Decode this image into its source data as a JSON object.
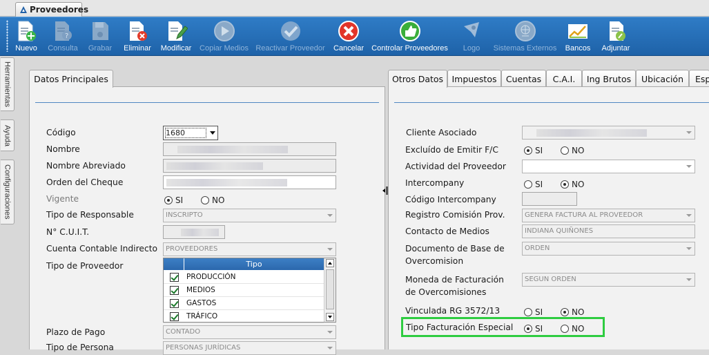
{
  "window": {
    "tab_title": "Proveedores"
  },
  "toolbar": [
    {
      "label": "Nuevo",
      "icon": "new-document-icon",
      "enabled": true
    },
    {
      "label": "Consulta",
      "icon": "query-document-icon",
      "enabled": false
    },
    {
      "label": "Grabar",
      "icon": "save-disk-icon",
      "enabled": false
    },
    {
      "label": "Eliminar",
      "icon": "delete-document-icon",
      "enabled": true
    },
    {
      "label": "Modificar",
      "icon": "edit-document-icon",
      "enabled": true
    },
    {
      "label": "Copiar Medios",
      "icon": "play-circle-icon",
      "enabled": false
    },
    {
      "label": "Reactivar Proveedor",
      "icon": "checkmark-icon",
      "enabled": false
    },
    {
      "label": "Cancelar",
      "icon": "cancel-x-icon",
      "enabled": true
    },
    {
      "label": "Controlar Proveedores",
      "icon": "thumbs-up-icon",
      "enabled": true
    },
    {
      "label": "Logo",
      "icon": "rocket-icon",
      "enabled": false
    },
    {
      "label": "Sistemas Externos",
      "icon": "globe-icon",
      "enabled": false
    },
    {
      "label": "Bancos",
      "icon": "chart-trend-icon",
      "enabled": true
    },
    {
      "label": "Adjuntar",
      "icon": "attach-document-icon",
      "enabled": true
    }
  ],
  "side_tabs": [
    "Herramientas",
    "Ayuda",
    "Configuraciones"
  ],
  "left_panel": {
    "tab": "Datos Principales",
    "codigo": {
      "label": "Código",
      "value": "1680"
    },
    "nombre": {
      "label": "Nombre"
    },
    "nombre_abreviado": {
      "label": "Nombre Abreviado"
    },
    "orden_cheque": {
      "label": "Orden del Cheque"
    },
    "vigente": {
      "label": "Vigente",
      "yes": "SI",
      "no": "NO",
      "selected": "SI"
    },
    "tipo_responsable": {
      "label": "Tipo de Responsable",
      "value": "INSCRIPTO"
    },
    "cuit": {
      "label": "N° C.U.I.T."
    },
    "cuenta_contable": {
      "label": "Cuenta Contable Indirecto",
      "value": "PROVEEDORES"
    },
    "tipo_proveedor": {
      "label": "Tipo de Proveedor",
      "column": "Tipo",
      "rows": [
        {
          "name": "PRODUCCIÓN",
          "checked": true
        },
        {
          "name": "MEDIOS",
          "checked": true
        },
        {
          "name": "GASTOS",
          "checked": true
        },
        {
          "name": "TRÁFICO",
          "checked": true
        }
      ]
    },
    "plazo_pago": {
      "label": "Plazo de Pago",
      "value": "CONTADO"
    },
    "tipo_persona": {
      "label": "Tipo de Persona",
      "value": "PERSONAS JURÍDICAS"
    }
  },
  "right_panel": {
    "tabs": [
      "Otros Datos",
      "Impuestos",
      "Cuentas",
      "C.A.I.",
      "Ing Brutos",
      "Ubicación",
      "Esp"
    ],
    "active_tab": "Otros Datos",
    "cliente_asociado": {
      "label": "Cliente Asociado"
    },
    "excluido": {
      "label": "Excluído de Emitir F/C",
      "yes": "SI",
      "no": "NO",
      "selected": "SI"
    },
    "actividad": {
      "label": "Actividad del Proveedor"
    },
    "intercompany": {
      "label": "Intercompany",
      "yes": "SI",
      "no": "NO",
      "selected": "NO"
    },
    "codigo_intercompany": {
      "label": "Código Intercompany"
    },
    "registro_comision": {
      "label": "Registro Comisión Prov.",
      "value": "GENERA FACTURA AL PROVEEDOR"
    },
    "contacto_medios": {
      "label": "Contacto de Medios",
      "value": "INDIANA QUIÑONES"
    },
    "documento_base": {
      "label_1": "Documento de Base de",
      "label_2": "Overcomision",
      "value": "ORDEN"
    },
    "moneda_facturacion": {
      "label_1": "Moneda de Facturación",
      "label_2": "de Overcomisiones",
      "value": "SEGUN ORDEN"
    },
    "vinculada": {
      "label": "Vinculada RG 3572/13",
      "yes": "SI",
      "no": "NO",
      "selected": "NO"
    },
    "tipo_facturacion": {
      "label": "Tipo Facturación Especial",
      "yes": "SI",
      "no": "NO",
      "selected": "SI"
    }
  },
  "colors": {
    "toolbar": "#2670b8",
    "highlight": "#2ecc40",
    "grid_header": "#3576bd"
  }
}
